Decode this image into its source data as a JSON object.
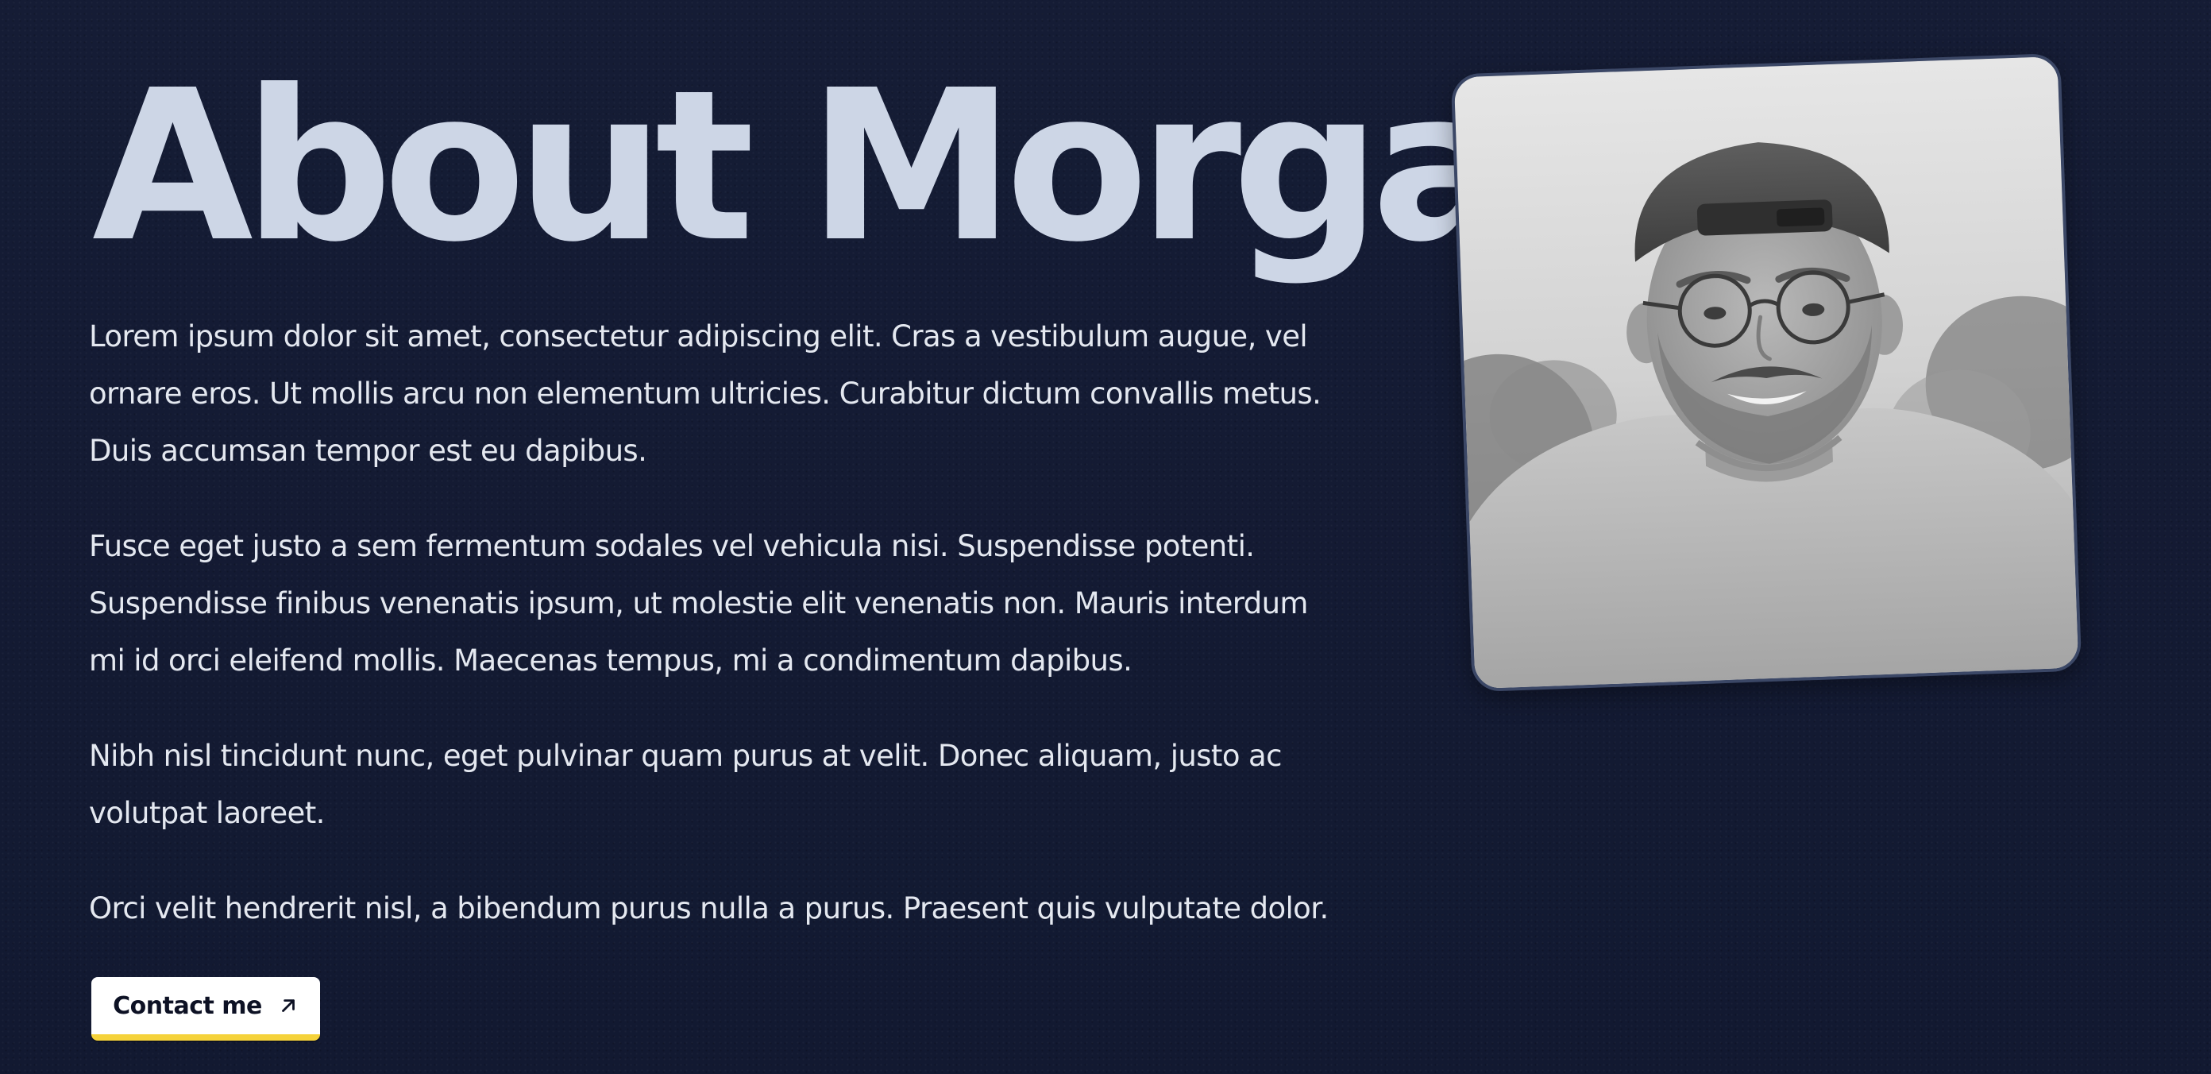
{
  "page": {
    "title": "About Morgan"
  },
  "about": {
    "paragraphs": [
      "Lorem ipsum dolor sit amet, consectetur adipiscing elit. Cras a vestibulum augue, vel ornare eros. Ut mollis arcu non elementum ultricies. Curabitur dictum convallis metus. Duis accumsan tempor est eu dapibus.",
      "Fusce eget justo a sem fermentum sodales vel vehicula nisi. Suspendisse potenti. Suspendisse finibus venenatis ipsum, ut molestie elit venenatis non. Mauris interdum mi id orci eleifend mollis. Maecenas tempus, mi a condimentum dapibus.",
      "Nibh nisl tincidunt nunc, eget pulvinar quam purus at velit. Donec aliquam, justo ac volutpat laoreet.",
      "Orci velit hendrerit nisl, a bibendum purus nulla a purus. Praesent quis vulputate dolor."
    ]
  },
  "contact_button": {
    "label": "Contact me",
    "icon": "arrow-up-right-icon"
  },
  "photo": {
    "subject": "portrait-photo"
  },
  "colors": {
    "background": "#141b33",
    "title": "#cdd6e6",
    "body_text": "#e4e8f0",
    "button_bg": "#ffffff",
    "button_accent": "#f5d23a",
    "photo_border": "#3b4766"
  }
}
